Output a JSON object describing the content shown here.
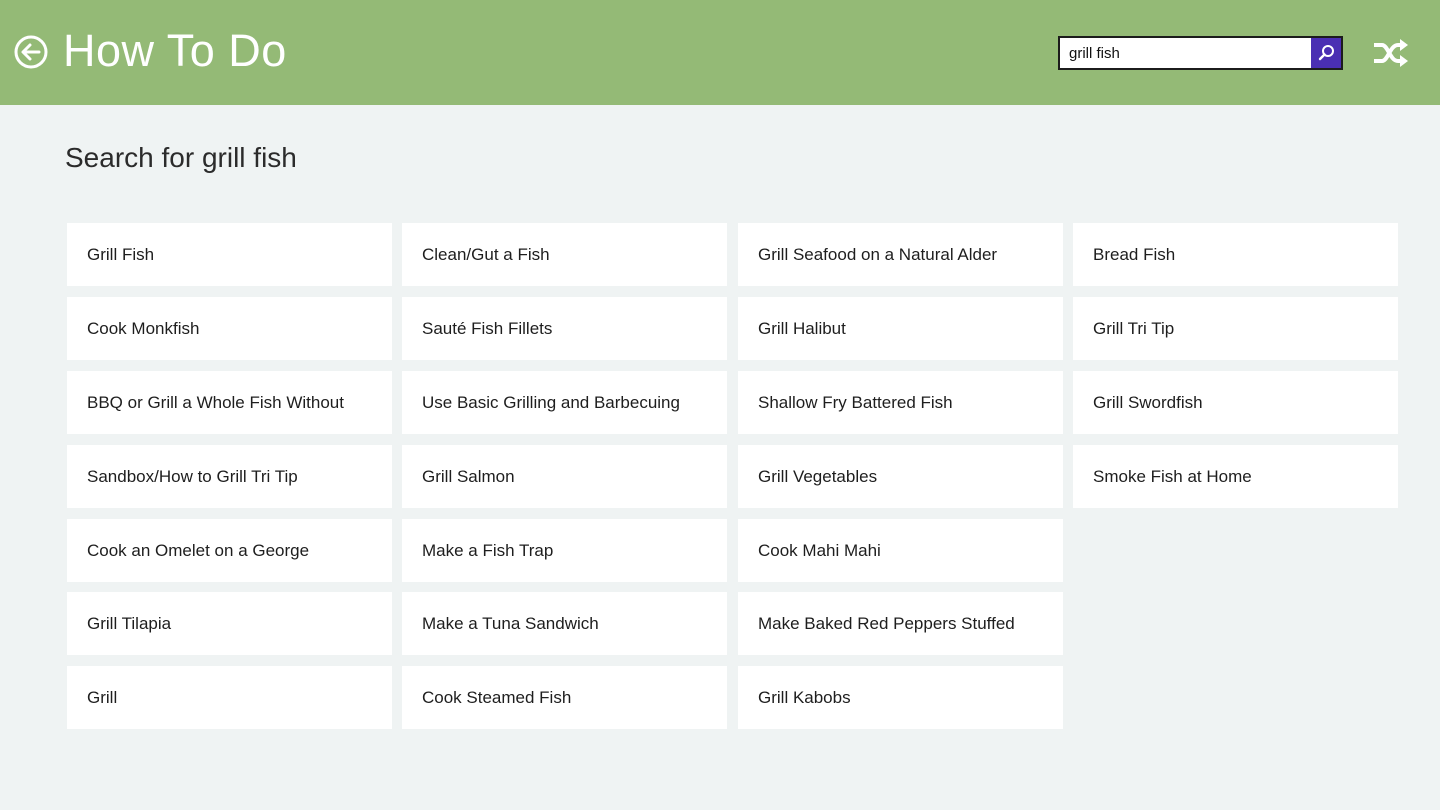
{
  "header": {
    "app_title": "How To Do",
    "back_icon": "back-arrow-circle-icon",
    "shuffle_icon": "shuffle-icon",
    "background_color": "#94ba76"
  },
  "search": {
    "value": "grill fish",
    "placeholder": "",
    "button_icon": "search-icon",
    "button_color": "#4a2fb3"
  },
  "main": {
    "heading": "Search for grill fish",
    "columns": [
      [
        "Grill Fish",
        "Cook Monkfish",
        "BBQ or Grill a Whole Fish Without",
        "Sandbox/How to Grill Tri Tip",
        "Cook an Omelet on a George",
        "Grill Tilapia",
        "Grill"
      ],
      [
        "Clean/Gut a Fish",
        "Sauté Fish Fillets",
        "Use Basic Grilling and Barbecuing",
        "Grill Salmon",
        "Make a Fish Trap",
        "Make a Tuna Sandwich",
        "Cook Steamed Fish"
      ],
      [
        "Grill Seafood on a Natural Alder",
        "Grill Halibut",
        "Shallow Fry Battered Fish",
        "Grill Vegetables",
        "Cook Mahi Mahi",
        "Make Baked Red Peppers Stuffed",
        "Grill Kabobs"
      ],
      [
        "Bread Fish",
        "Grill Tri Tip",
        "Grill Swordfish",
        "Smoke Fish at Home"
      ]
    ]
  }
}
